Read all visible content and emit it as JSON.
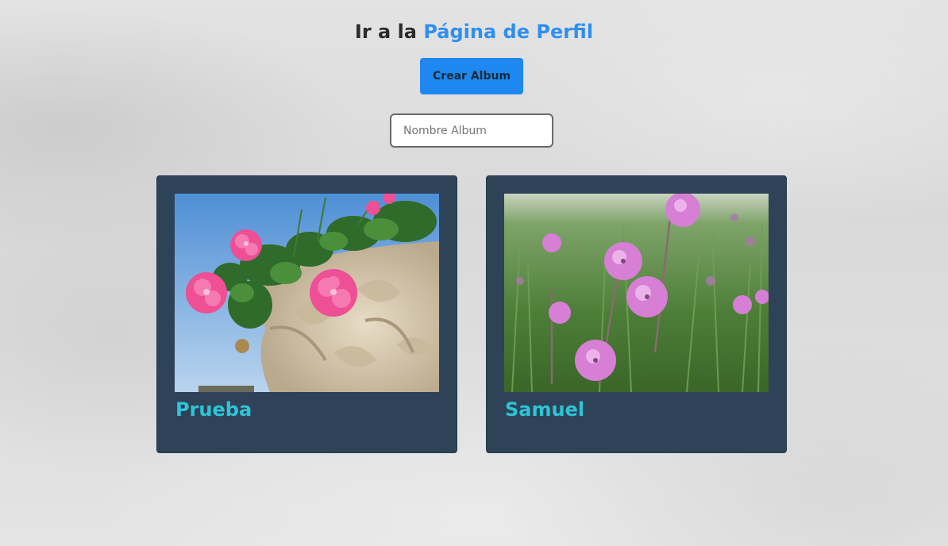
{
  "header": {
    "prefix": "Ir a la",
    "link_label": "Página de Perfil"
  },
  "create_button": {
    "label": "Crear Album"
  },
  "album_name_input": {
    "placeholder": "Nombre Album",
    "value": ""
  },
  "albums": [
    {
      "title": "Prueba"
    },
    {
      "title": "Samuel"
    }
  ],
  "colors": {
    "link": "#2f8ff0",
    "button_bg": "#1e88f0",
    "card_bg": "#2e4258",
    "album_title": "#2ec4d6"
  }
}
